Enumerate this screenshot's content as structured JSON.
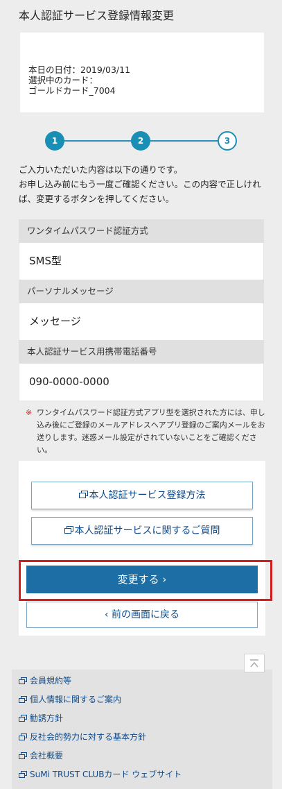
{
  "header": {
    "title": "本人認証サービス登録情報変更"
  },
  "info": {
    "date_line": "本日の日付：2019/03/11",
    "card_label": "選択中のカード：",
    "card_name": "ゴールドカード_7004"
  },
  "steps": [
    "1",
    "2",
    "3"
  ],
  "lead": {
    "line1": "ご入力いただいた内容は以下の通りです。",
    "line2": "お申し込み前にもう一度ご確認ください。この内容で正しければ、変更するボタンを押してください。"
  },
  "fields": [
    {
      "label": "ワンタイムパスワード認証方式",
      "value": "SMS型"
    },
    {
      "label": "パーソナルメッセージ",
      "value": "メッセージ"
    },
    {
      "label": "本人認証サービス用携帯電話番号",
      "value": "090-0000-0000"
    }
  ],
  "note": {
    "mark": "※",
    "text": "ワンタイムパスワード認証方式アプリ型を選択された方には、申し込み後にご登録のメールアドレスへアプリ登録のご案内メールをお送りします。迷惑メール設定がされていないことをご確認ください。"
  },
  "links": {
    "register_method": "本人認証サービス登録方法",
    "faq": "本人認証サービスに関するご質問"
  },
  "actions": {
    "submit": "変更する ›",
    "back": "‹ 前の画面に戻る"
  },
  "footer": [
    "会員規約等",
    "個人情報に関するご案内",
    "勧誘方針",
    "反社会的勢力に対する基本方針",
    "会社概要",
    "SuMi TRUST CLUBカード ウェブサイト"
  ],
  "colors": {
    "accent": "#1a8fb5",
    "primary": "#1c6ea4",
    "highlight": "#d41e1e",
    "note_mark": "#d42020"
  },
  "icons": {
    "external_link": "window-link-icon",
    "page_top": "chevron-up-icon"
  }
}
